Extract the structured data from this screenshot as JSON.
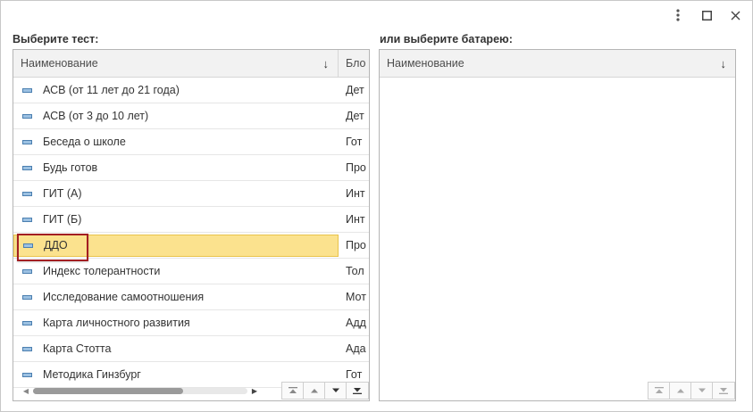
{
  "window": {
    "menu_icon": "kebab-menu-icon",
    "maximize_icon": "maximize-icon",
    "close_icon": "close-icon"
  },
  "left": {
    "caption": "Выберите тест:",
    "columns": [
      "Наименование",
      "Блок"
    ],
    "sort_indicator": "↓",
    "rows": [
      {
        "name": "АСВ (от 11 лет до 21 года)",
        "block": "Детско-родительские отношения",
        "selected": false
      },
      {
        "name": "АСВ (от 3 до 10 лет)",
        "block": "Детско-родительские отношения",
        "selected": false
      },
      {
        "name": "Беседа о школе",
        "block": "Готовность к школе",
        "selected": false
      },
      {
        "name": "Будь готов",
        "block": "Профориентация",
        "selected": false
      },
      {
        "name": "ГИТ (А)",
        "block": "Интеллект",
        "selected": false
      },
      {
        "name": "ГИТ (Б)",
        "block": "Интеллект",
        "selected": false
      },
      {
        "name": "ДДО",
        "block": "Профориентация",
        "selected": true
      },
      {
        "name": "Индекс толерантности",
        "block": "Толерантность",
        "selected": false
      },
      {
        "name": "Исследование самоотношения",
        "block": "Мотивация",
        "selected": false
      },
      {
        "name": "Карта личностного развития",
        "block": "Аддикции",
        "selected": false
      },
      {
        "name": "Карта Стотта",
        "block": "Адаптация",
        "selected": false
      },
      {
        "name": "Методика Гинзбург",
        "block": "Готовность к школе",
        "selected": false
      }
    ],
    "visible_block_text": [
      "Дет",
      "Дет",
      "Гот",
      "Про",
      "Инт",
      "Инт",
      "Про",
      "Тол",
      "Мот",
      "Адд",
      "Ада",
      "Гот"
    ],
    "header_block_visible": "Бло"
  },
  "right": {
    "caption": "или выберите батарею:",
    "columns": [
      "Наименование"
    ],
    "sort_indicator": "↓",
    "rows": []
  },
  "nav_icons": [
    "first-page-icon",
    "prev-page-icon",
    "next-page-icon",
    "last-page-icon"
  ]
}
